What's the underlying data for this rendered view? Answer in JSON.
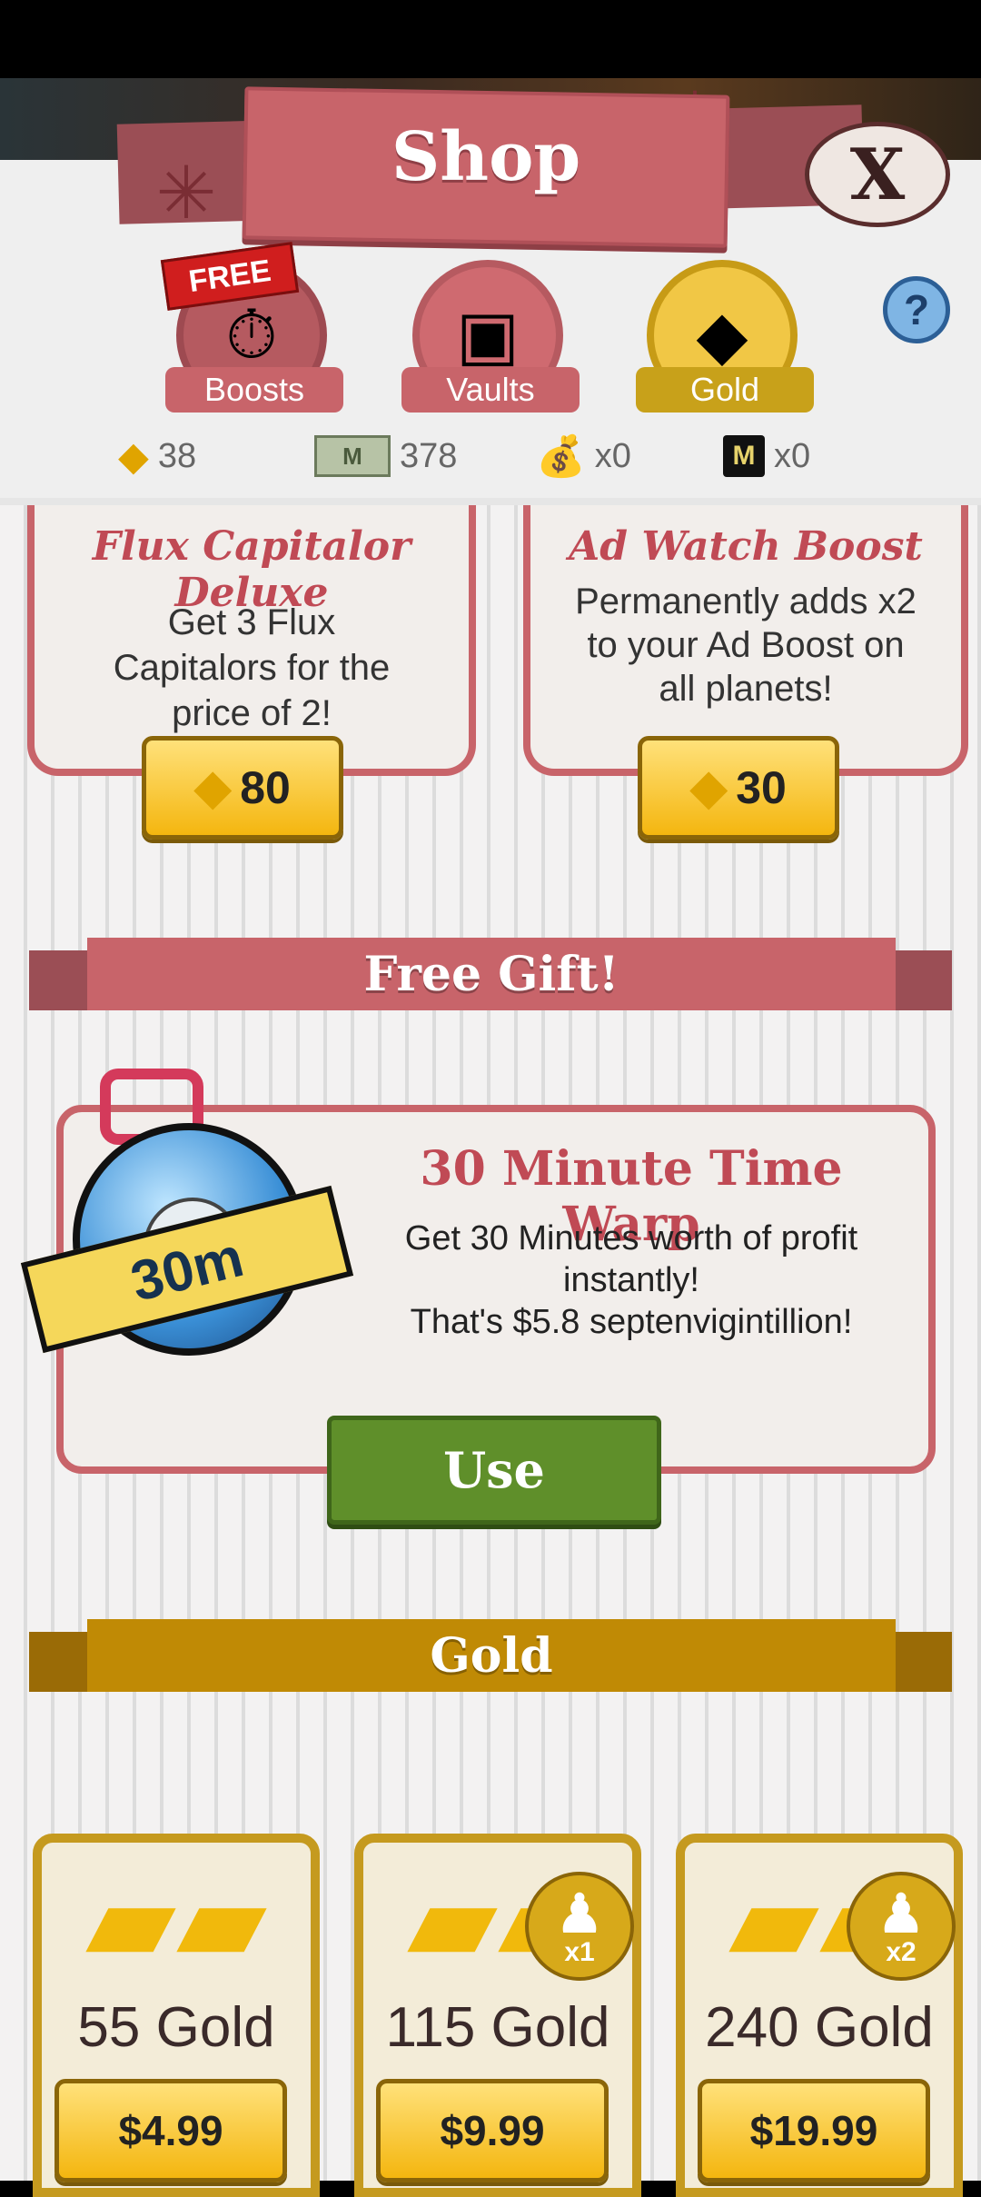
{
  "header": {
    "title": "Shop",
    "close_label": "X"
  },
  "tabs": [
    {
      "label": "Boosts",
      "badge": "FREE",
      "icon": "stopwatch-icon"
    },
    {
      "label": "Vaults",
      "icon": "vault-icon"
    },
    {
      "label": "Gold",
      "icon": "gold-gem-icon",
      "selected": true
    }
  ],
  "help_label": "?",
  "currencies": [
    {
      "icon": "gold-gem-icon",
      "value": "38"
    },
    {
      "icon": "megabucks-icon",
      "icon_text": "M",
      "value": "378"
    },
    {
      "icon": "money-bag-icon",
      "value": "x0"
    },
    {
      "icon": "flux-chip-icon",
      "icon_text": "M",
      "value": "x0"
    }
  ],
  "boost_cards": [
    {
      "title": "Flux Capitalor Deluxe",
      "description": "Get 3 Flux Capitalors for the price of 2!",
      "price": "80"
    },
    {
      "title": "Ad Watch Boost",
      "description": "Permanently adds x2 to your Ad Boost on all planets!",
      "price": "30"
    }
  ],
  "free_gift": {
    "section_title": "Free Gift!",
    "item_title": "30 Minute Time Warp",
    "description_line1": "Get 30 Minutes worth of profit instantly!",
    "description_line2": "That's $5.8 septenvigintillion!",
    "badge": "30m",
    "button_label": "Use"
  },
  "gold_section": {
    "title": "Gold",
    "packs": [
      {
        "name": "55 Gold",
        "price": "$4.99"
      },
      {
        "name": "115 Gold",
        "price": "$9.99",
        "multiplier": "x1"
      },
      {
        "name": "240 Gold",
        "price": "$19.99",
        "multiplier": "x2"
      }
    ]
  },
  "colors": {
    "accent_red": "#c8646a",
    "gold": "#c8a11a",
    "button_green": "#5f8f2a",
    "button_yellow": "#f4b60f"
  }
}
